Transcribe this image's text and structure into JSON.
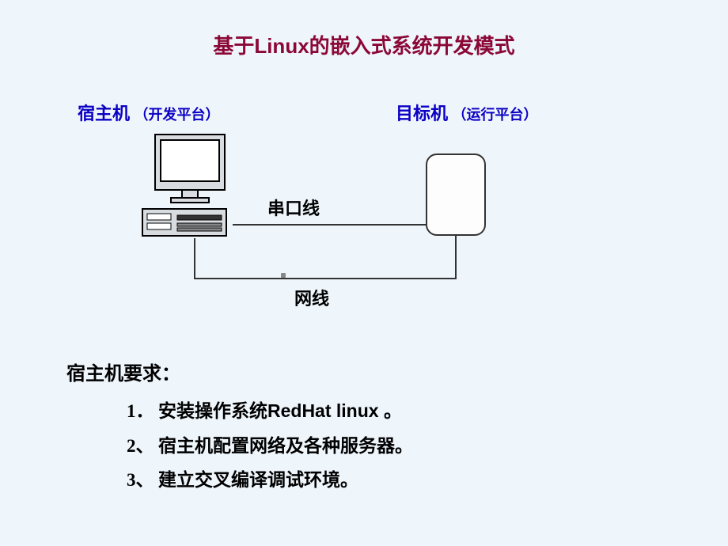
{
  "title": "基于Linux的嵌入式系统开发模式",
  "host": {
    "label": "宿主机",
    "sub": "（开发平台）"
  },
  "target": {
    "label": "目标机",
    "sub": "（运行平台）"
  },
  "connections": {
    "serial": "串口线",
    "network": "网线"
  },
  "requirements": {
    "heading": "宿主机要求：",
    "items": [
      {
        "num": "1．",
        "text": "安装操作系统RedHat linux 。"
      },
      {
        "num": "2、",
        "text": "宿主机配置网络及各种服务器。"
      },
      {
        "num": "3、",
        "text": "建立交叉编译调试环境。"
      }
    ]
  }
}
